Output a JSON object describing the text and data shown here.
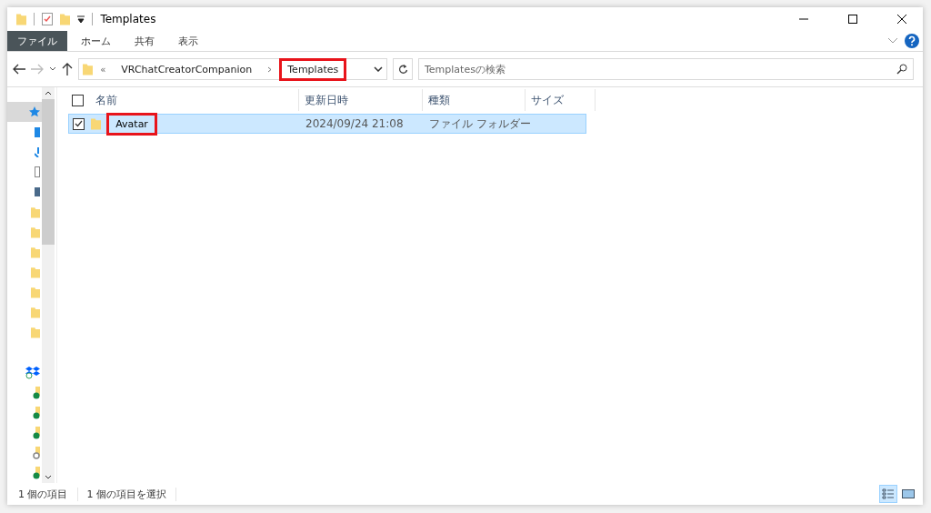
{
  "window": {
    "title": "Templates"
  },
  "ribbon_tabs": [
    {
      "label": "ファイル",
      "kind": "file"
    },
    {
      "label": "ホーム",
      "kind": "normal"
    },
    {
      "label": "共有",
      "kind": "normal"
    },
    {
      "label": "表示",
      "kind": "normal"
    }
  ],
  "address_bar": {
    "overflow": "«",
    "path": [
      {
        "label": "VRChatCreatorCompanion",
        "highlighted": false
      },
      {
        "label": "Templates",
        "highlighted": true
      }
    ]
  },
  "search": {
    "placeholder": "Templatesの検索"
  },
  "nav_pane": [
    {
      "kind": "star",
      "selected": true
    },
    {
      "kind": "desktop",
      "selected": false
    },
    {
      "kind": "download",
      "selected": false
    },
    {
      "kind": "document",
      "selected": false
    },
    {
      "kind": "picture",
      "selected": false
    },
    {
      "kind": "folder",
      "selected": false
    },
    {
      "kind": "folder",
      "selected": false
    },
    {
      "kind": "folder",
      "selected": false
    },
    {
      "kind": "folder",
      "selected": false
    },
    {
      "kind": "folder",
      "selected": false
    },
    {
      "kind": "folder",
      "selected": false
    },
    {
      "kind": "folder",
      "selected": false
    },
    {
      "kind": "gap",
      "selected": false
    },
    {
      "kind": "dropbox",
      "selected": false
    },
    {
      "kind": "synced",
      "selected": false
    },
    {
      "kind": "synced",
      "selected": false
    },
    {
      "kind": "synced",
      "selected": false
    },
    {
      "kind": "pending",
      "selected": false
    },
    {
      "kind": "synced",
      "selected": false
    }
  ],
  "table": {
    "all_checked": false,
    "columns": [
      "名前",
      "更新日時",
      "種類",
      "サイズ"
    ],
    "rows": [
      {
        "name": "Avatar",
        "modified": "2024/09/24 21:08",
        "type": "ファイル フォルダー",
        "selected": true,
        "checked": true,
        "highlighted": true
      }
    ]
  },
  "status_bar": {
    "count": "1 個の項目",
    "selection": "1 個の項目を選択"
  },
  "view_buttons": [
    {
      "kind": "details",
      "selected": true
    },
    {
      "kind": "large",
      "selected": false
    }
  ]
}
